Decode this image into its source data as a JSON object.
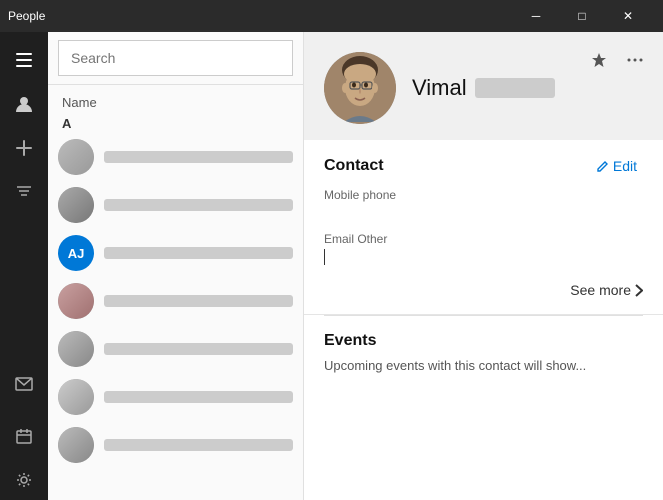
{
  "titleBar": {
    "title": "People",
    "minimizeLabel": "Minimize",
    "maximizeLabel": "Maximize",
    "closeLabel": "Close",
    "minimizeIcon": "─",
    "maximizeIcon": "□",
    "closeIcon": "✕"
  },
  "iconRail": {
    "hamburgerIcon": "☰",
    "personIcon": "👤",
    "addIcon": "+",
    "filterIcon": "▽",
    "mailIcon": "✉",
    "calendarIcon": "📅",
    "settingsIcon": "⚙"
  },
  "contactList": {
    "searchPlaceholder": "Search",
    "nameColumnLabel": "Name",
    "sectionLetter": "A",
    "contacts": [
      {
        "id": 1,
        "type": "photo",
        "avatarColor": "#888"
      },
      {
        "id": 2,
        "type": "photo",
        "avatarColor": "#888"
      },
      {
        "id": 3,
        "type": "initials",
        "initials": "AJ",
        "avatarColor": "#0078d7"
      },
      {
        "id": 4,
        "type": "photo",
        "avatarColor": "#888"
      },
      {
        "id": 5,
        "type": "photo",
        "avatarColor": "#888"
      },
      {
        "id": 6,
        "type": "photo",
        "avatarColor": "#888"
      },
      {
        "id": 7,
        "type": "photo",
        "avatarColor": "#888"
      }
    ]
  },
  "profile": {
    "firstName": "Vimal",
    "lastNameBlurred": true,
    "pinIcon": "📌",
    "moreIcon": "•••"
  },
  "contactDetail": {
    "sectionTitle": "Contact",
    "editLabel": "Edit",
    "editIcon": "✏",
    "mobilePhoneLabel": "Mobile phone",
    "mobilePhoneValue": "",
    "emailOtherLabel": "Email Other",
    "emailOtherValue": "",
    "seeMoreLabel": "See more",
    "chevronRightIcon": "›"
  },
  "events": {
    "title": "Events",
    "description": "Upcoming events with this contact will show..."
  }
}
